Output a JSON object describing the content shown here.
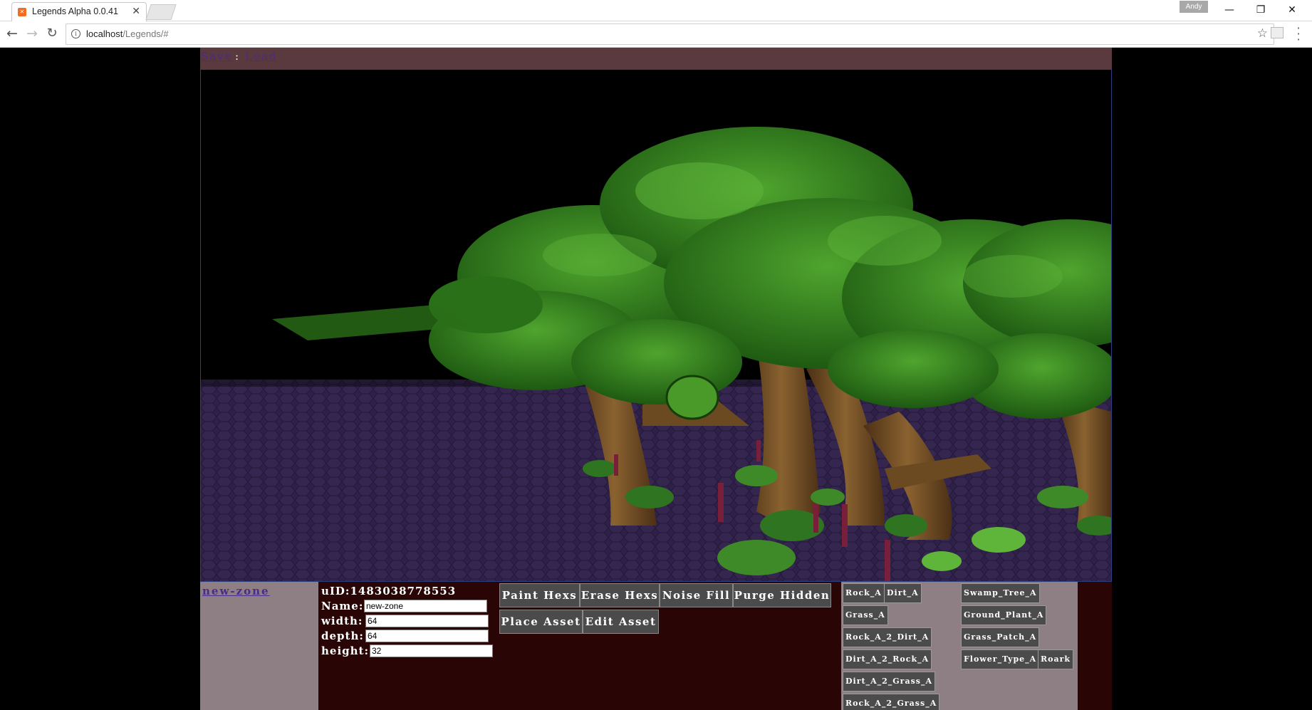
{
  "browser": {
    "tab_title": "Legends Alpha 0.0.41",
    "tab_close": "✕",
    "profile": "Andy",
    "url_host": "localhost",
    "url_path": "/Legends/#",
    "controls": {
      "minimize": "—",
      "maximize": "❐",
      "close": "✕"
    }
  },
  "nav": {
    "save": "Save",
    "separator": ":",
    "load": "Load"
  },
  "zone": {
    "link": "new-zone",
    "uid_label": "uID:",
    "uid": "1483038778553",
    "fields": [
      {
        "label": "Name:",
        "value": "new-zone"
      },
      {
        "label": "width:",
        "value": "64"
      },
      {
        "label": "depth:",
        "value": "64"
      },
      {
        "label": "height:",
        "value": "32"
      }
    ]
  },
  "tools": [
    "Paint Hexs",
    "Erase Hexs",
    "Noise Fill",
    "Purge Hidden",
    "Place Asset",
    "Edit Asset"
  ],
  "tiles": [
    "Rock_A",
    "Dirt_A",
    "Grass_A",
    "Rock_A_2_Dirt_A",
    "Dirt_A_2_Rock_A",
    "Dirt_A_2_Grass_A",
    "Rock_A_2_Grass_A"
  ],
  "assets": [
    "Swamp_Tree_A",
    "Ground_Plant_A",
    "Grass_Patch_A",
    "Flower_Type_A",
    "Roark"
  ],
  "colors": {
    "nav_bar": "#5a3a3e",
    "panel": "#8e7f84",
    "bottom_bg": "#2a0505",
    "button": "#4b4b4b",
    "link": "#4a2a8a",
    "ground": "#2e2048",
    "foliage": "#2f7f1d",
    "trunk": "#6b4a22"
  }
}
